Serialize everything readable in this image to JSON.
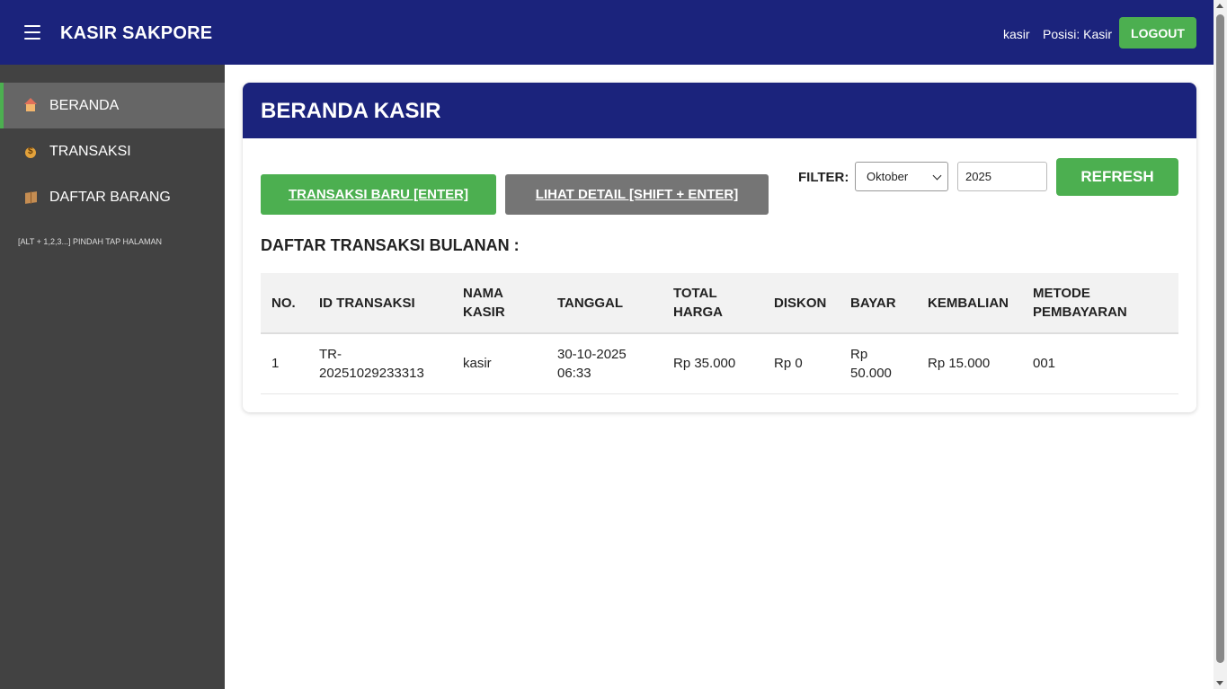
{
  "header": {
    "app_title": "KASIR SAKPORE",
    "username": "kasir",
    "position": "Posisi: Kasir",
    "logout_label": "LOGOUT"
  },
  "sidebar": {
    "items": [
      {
        "label": "BERANDA",
        "icon": "house-icon",
        "active": true
      },
      {
        "label": "TRANSAKSI",
        "icon": "money-bag-icon",
        "active": false
      },
      {
        "label": "DAFTAR BARANG",
        "icon": "package-icon",
        "active": false
      }
    ],
    "shortcut_hint": "[ALT + 1,2,3...] PINDAH TAP HALAMAN"
  },
  "main": {
    "title": "BERANDA KASIR",
    "new_transaction_label": "TRANSAKSI BARU [ENTER]",
    "view_detail_label": "LIHAT DETAIL [SHIFT + ENTER]",
    "filter_label": "FILTER:",
    "month_value": "Oktober",
    "year_value": "2025",
    "refresh_label": "REFRESH",
    "section_title": "DAFTAR TRANSAKSI BULANAN :"
  },
  "table": {
    "headers": [
      "NO.",
      "ID TRANSAKSI",
      "NAMA KASIR",
      "TANGGAL",
      "TOTAL HARGA",
      "DISKON",
      "BAYAR",
      "KEMBALIAN",
      "METODE PEMBAYARAN"
    ],
    "rows": [
      [
        "1",
        "TR-20251029233313",
        "kasir",
        "30-10-2025 06:33",
        "Rp 35.000",
        "Rp 0",
        "Rp 50.000",
        "Rp 15.000",
        "001"
      ]
    ]
  },
  "colors": {
    "navy": "#1b237c",
    "green": "#4caf50",
    "gray_button": "#757575",
    "sidebar_bg": "#424242",
    "sidebar_active": "#666666"
  }
}
